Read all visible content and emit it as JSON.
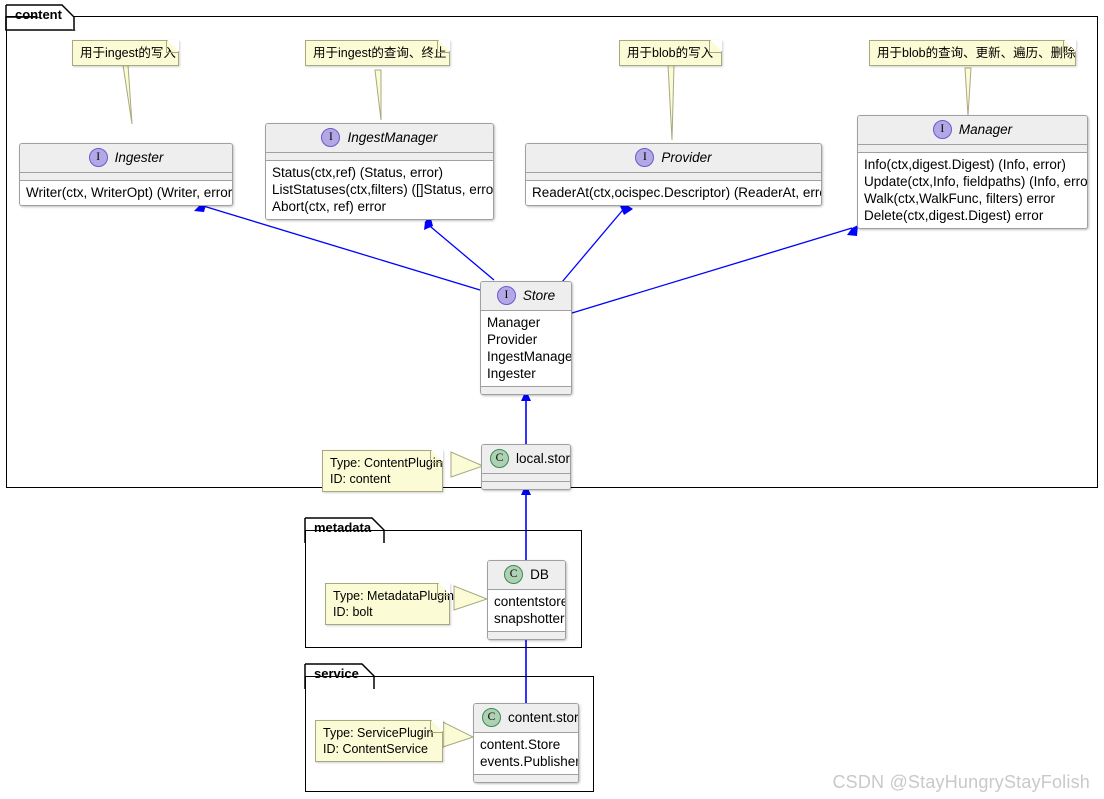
{
  "diagram": {
    "type": "uml-class-diagram",
    "watermark": "CSDN @StayHungryStayFolish",
    "link_color": "#0000FF",
    "note_fill": "#FBFBD5",
    "note_border": "#A9A980",
    "interface_badge_fill": "#B4A7E5",
    "class_badge_fill": "#ADD1B2",
    "box_header_fill": "#EEEEEE",
    "box_body_fill": "#FFFFFF"
  },
  "packages": [
    {
      "name": "content"
    },
    {
      "name": "metadata"
    },
    {
      "name": "service"
    }
  ],
  "interfaces": {
    "ingester": {
      "stereotype": "I",
      "name": "Ingester",
      "methods": [
        "Writer(ctx, WriterOpt) (Writer, error)"
      ]
    },
    "ingest_manager": {
      "stereotype": "I",
      "name": "IngestManager",
      "methods": [
        "Status(ctx,ref) (Status, error)",
        "ListStatuses(ctx,filters) ([]Status, error)",
        "Abort(ctx, ref) error"
      ]
    },
    "provider": {
      "stereotype": "I",
      "name": "Provider",
      "methods": [
        "ReaderAt(ctx,ocispec.Descriptor) (ReaderAt, error)"
      ]
    },
    "manager": {
      "stereotype": "I",
      "name": "Manager",
      "methods": [
        "Info(ctx,digest.Digest) (Info, error)",
        "Update(ctx,Info, fieldpaths) (Info, error)",
        "Walk(ctx,WalkFunc, filters) error",
        "Delete(ctx,digest.Digest) error"
      ]
    },
    "store": {
      "stereotype": "I",
      "name": "Store",
      "methods": [
        "Manager",
        "Provider",
        "IngestManager",
        "Ingester"
      ]
    }
  },
  "classes": {
    "local_store": {
      "stereotype": "C",
      "name": "local.store",
      "members": []
    },
    "db": {
      "stereotype": "C",
      "name": "DB",
      "members": [
        "contentstore",
        "snapshotter"
      ]
    },
    "content_store": {
      "stereotype": "C",
      "name": "content.store",
      "members": [
        "content.Store",
        "events.Publisher"
      ]
    }
  },
  "notes": {
    "note_ingester": {
      "lines": [
        "用于ingest的写入"
      ]
    },
    "note_ingest_manager": {
      "lines": [
        "用于ingest的查询、终止"
      ]
    },
    "note_provider": {
      "lines": [
        "用于blob的写入"
      ]
    },
    "note_manager": {
      "lines": [
        "用于blob的查询、更新、遍历、删除"
      ]
    },
    "note_local_store": {
      "lines": [
        "Type: ContentPlugin",
        "ID: content"
      ]
    },
    "note_db": {
      "lines": [
        "Type: MetadataPlugin",
        "ID: bolt"
      ]
    },
    "note_content_store": {
      "lines": [
        "Type: ServicePlugin",
        "ID: ContentService"
      ]
    }
  }
}
